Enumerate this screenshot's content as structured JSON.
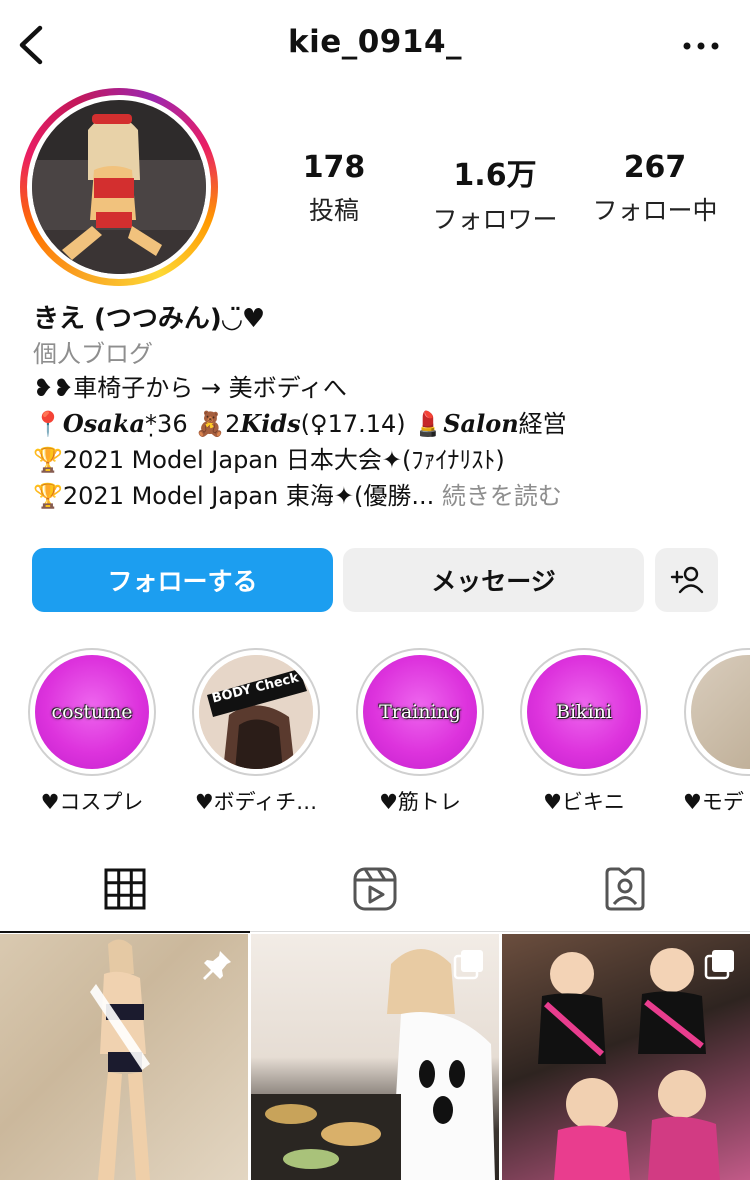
{
  "header": {
    "username": "kie_0914_"
  },
  "stats": {
    "posts": {
      "value": "178",
      "label": "投稿"
    },
    "followers": {
      "value": "1.6万",
      "label": "フォロワー"
    },
    "following": {
      "value": "267",
      "label": "フォロー中"
    }
  },
  "bio": {
    "name": "きえ (つつみん)◡̈♥",
    "category": "個人ブログ",
    "line1": "❥❥車椅子から → 美ボディへ",
    "line2_pin": "📍",
    "line2_osaka": "Osaka",
    "line2_age": "*̣36 🧸2",
    "line2_kids": "Kids",
    "line2_kids_ages": "(♀17.14) 💄",
    "line2_salon": "Salon",
    "line2_tail": "経営",
    "line3": "🏆2021 Model Japan 日本大会✦(ﾌｧｲﾅﾘｽﾄ)",
    "line4": "🏆2021 Model Japan 東海✦(優勝...",
    "more": " 続きを読む"
  },
  "actions": {
    "follow": "フォローする",
    "message": "メッセージ"
  },
  "highlights": [
    {
      "title": "costume",
      "label": "♥コスプレ"
    },
    {
      "title": "BODY Check",
      "label": "♥ボディチ…"
    },
    {
      "title": "Training",
      "label": "♥筋トレ"
    },
    {
      "title": "Bikini",
      "label": "♥ビキニ"
    },
    {
      "title": "",
      "label": "♥モデ"
    }
  ],
  "colors": {
    "follow_button": "#1c9ef0",
    "secondary_button": "#efefef",
    "highlight_pink": "#dd33dd",
    "muted_text": "#8e8e8e"
  },
  "icons": {
    "back": "chevron-left-icon",
    "more": "ellipsis-icon",
    "add_user": "add-user-icon",
    "grid_tab": "grid-icon",
    "reels_tab": "reels-icon",
    "tagged_tab": "tagged-icon",
    "pinned": "pin-icon",
    "multi": "carousel-icon"
  }
}
